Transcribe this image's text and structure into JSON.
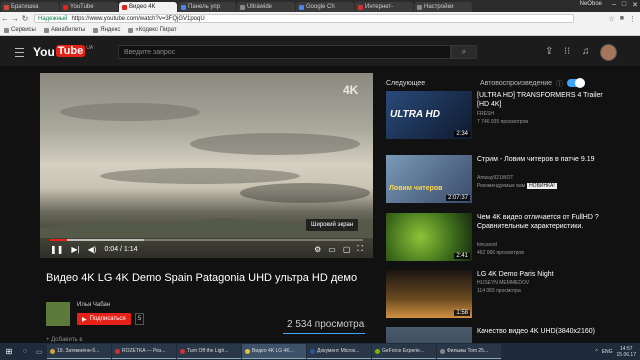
{
  "browser": {
    "tabs": [
      {
        "label": "Братишка",
        "color": "#d04a3a",
        "active": false
      },
      {
        "label": "YouTube",
        "color": "#e62117",
        "active": false
      },
      {
        "label": "Видео 4K",
        "color": "#e62117",
        "active": true
      },
      {
        "label": "Панель упр",
        "color": "#4a86e8",
        "active": false
      },
      {
        "label": "Ultrawide",
        "color": "#888888",
        "active": false
      },
      {
        "label": "Google Ch",
        "color": "#4a86e8",
        "active": false
      },
      {
        "label": "Интернет-",
        "color": "#cc3333",
        "active": false
      },
      {
        "label": "Настройки",
        "color": "#888888",
        "active": false
      }
    ],
    "user": "NeOboe",
    "secure_label": "Надежный",
    "url": "https://www.youtube.com/watch?v=3FQjGV1poqU",
    "bookmarks": [
      "Сервисы",
      "Авиабилеты",
      "Яндекс",
      "«Кодекс Пират"
    ]
  },
  "youtube": {
    "logo_you": "You",
    "logo_tube": "Tube",
    "logo_region": "UA",
    "search_placeholder": "Введите запрос"
  },
  "player": {
    "badge": "4K",
    "tooltip": "Широкий экран",
    "time": "0:04 / 1:14",
    "progress": 0.054,
    "loaded": 0.3
  },
  "video": {
    "title": "Видео 4K LG 4K Demo Spain Patagonia UHD ультра HD демо",
    "channel": "Илья Чабан",
    "subscribe_label": "Подписаться",
    "subscriber_count": "5",
    "views": "2 534 просмотра",
    "add_to": "+ Добавить в"
  },
  "sidebar": {
    "next_label": "Следующее",
    "autoplay_label": "Автовоспроизведение",
    "items": [
      {
        "title": "[ULTRA HD] TRANSFORMERS 4 Trailer [HD 4K]",
        "channel": "FRESH",
        "views": "7 746 935 просмотров",
        "duration": "2:34",
        "badge": "",
        "thumb_label": "ULTRA HD"
      },
      {
        "title": "Стрим - Ловим читеров в патче 9.19",
        "channel": "Amway921WOT",
        "views": "Рекомендуемые вам",
        "duration": "2:07:37",
        "badge": "НОВИНКА!",
        "thumb_label": "Ловим читеров"
      },
      {
        "title": "Чем 4K видео отличается от FullHD ? Сравнительные характеристики.",
        "channel": "kincavod",
        "views": "462 066 просмотров",
        "duration": "2:41",
        "badge": "",
        "thumb_label": ""
      },
      {
        "title": "LG 4K Demo Paris Night",
        "channel": "HUSEYN MEMMEDOV",
        "views": "114 083 просмотра",
        "duration": "1:58",
        "badge": "",
        "thumb_label": ""
      },
      {
        "title": "Качество видео 4K UHD(3840x2160)",
        "channel": "",
        "views": "",
        "duration": "",
        "badge": "",
        "thumb_label": ""
      }
    ]
  },
  "taskbar": {
    "items": [
      {
        "label": "19. Затемнённ-б...",
        "color": "#d4a03a"
      },
      {
        "label": "ROZETKA — Рез...",
        "color": "#cc3333"
      },
      {
        "label": "Turn Off the Ligh...",
        "color": "#cc3333"
      },
      {
        "label": "Видео 4K LG 4K...",
        "color": "#e0c040",
        "active": true
      },
      {
        "label": "Документ Micros...",
        "color": "#2b5797"
      },
      {
        "label": "GeForce Experie...",
        "color": "#76b900"
      },
      {
        "label": "Фильмы Tom 25...",
        "color": "#888888"
      }
    ],
    "lang": "ENG",
    "time": "14:57",
    "date": "15.06.17"
  }
}
